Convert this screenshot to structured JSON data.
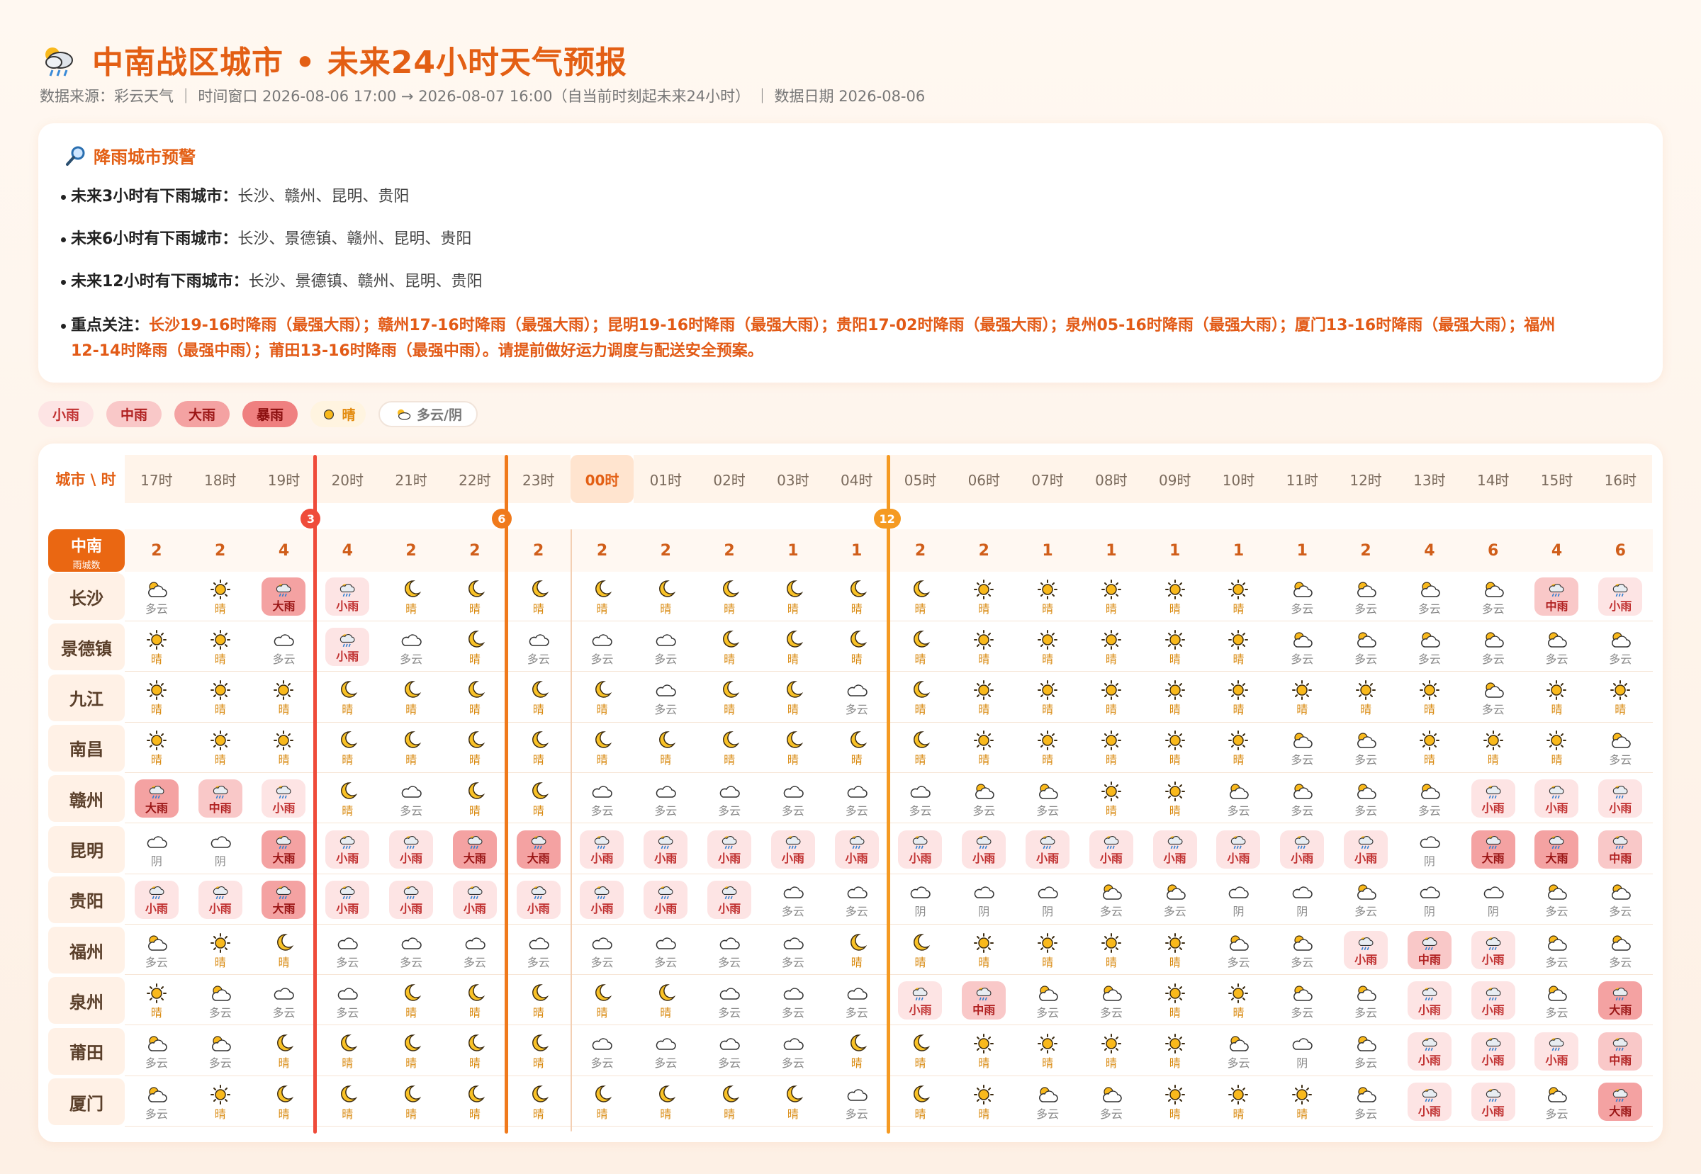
{
  "header": {
    "title": "中南战区城市 • 未来24小时天气预报",
    "subtitle": "数据来源：彩云天气 ｜ 时间窗口 2026-08-06 17:00 → 2026-08-07 16:00（自当前时刻起未来24小时） ｜ 数据日期 2026-08-06",
    "title_icon": "cloud-rain-sun-icon"
  },
  "alert": {
    "title": "降雨城市预警",
    "icon": "magnifier-icon",
    "lines": [
      {
        "label": "未来3小时有下雨城市：",
        "text": "长沙、赣州、昆明、贵阳"
      },
      {
        "label": "未来6小时有下雨城市：",
        "text": "长沙、景德镇、赣州、昆明、贵阳"
      },
      {
        "label": "未来12小时有下雨城市：",
        "text": "长沙、景德镇、赣州、昆明、贵阳"
      }
    ],
    "focus_label": "重点关注：",
    "focus_line1": "长沙19-16时降雨（最强大雨）；赣州17-16时降雨（最强大雨）；昆明19-16时降雨（最强大雨）；贵阳17-02时降雨（最强大雨）；泉州05-16时降雨（最强大雨）；厦门13-16时降雨（最强大雨）；福州",
    "focus_line2": "12-14时降雨（最强中雨）；莆田13-16时降雨（最强中雨）。请提前做好运力调度与配送安全预案。"
  },
  "legend": {
    "xs": "小雨",
    "md": "中雨",
    "lg": "大雨",
    "hv": "暴雨",
    "sun": "晴",
    "cloud": "多云/阴"
  },
  "table": {
    "corner": "城市 \\ 时",
    "summary_label": "中南",
    "summary_sub": "雨城数",
    "hours": [
      "17时",
      "18时",
      "19时",
      "20时",
      "21时",
      "22时",
      "23时",
      "00时",
      "01时",
      "02时",
      "03时",
      "04时",
      "05时",
      "06时",
      "07时",
      "08时",
      "09时",
      "10时",
      "11时",
      "12时",
      "13时",
      "14时",
      "15时",
      "16时"
    ],
    "now_index": 7,
    "rain_counts": [
      2,
      2,
      4,
      4,
      2,
      2,
      2,
      2,
      2,
      2,
      1,
      1,
      2,
      2,
      1,
      1,
      1,
      1,
      1,
      2,
      4,
      6,
      4,
      6
    ],
    "markers": [
      {
        "label": "3",
        "after": 2,
        "color": "#ef4b3a"
      },
      {
        "label": "6",
        "after": 5,
        "color": "#f07a1c"
      },
      {
        "label": "12",
        "after": 11,
        "color": "#f59a22"
      }
    ],
    "cities": [
      {
        "name": "长沙",
        "cells": [
          [
            "pc",
            "多云"
          ],
          [
            "su",
            "晴"
          ],
          [
            "r3",
            "大雨"
          ],
          [
            "r1",
            "小雨"
          ],
          [
            "mo",
            "晴"
          ],
          [
            "mo",
            "晴"
          ],
          [
            "mo",
            "晴"
          ],
          [
            "mo",
            "晴"
          ],
          [
            "mo",
            "晴"
          ],
          [
            "mo",
            "晴"
          ],
          [
            "mo",
            "晴"
          ],
          [
            "mo",
            "晴"
          ],
          [
            "mo",
            "晴"
          ],
          [
            "su",
            "晴"
          ],
          [
            "su",
            "晴"
          ],
          [
            "su",
            "晴"
          ],
          [
            "su",
            "晴"
          ],
          [
            "su",
            "晴"
          ],
          [
            "pc",
            "多云"
          ],
          [
            "pc",
            "多云"
          ],
          [
            "pc",
            "多云"
          ],
          [
            "pc",
            "多云"
          ],
          [
            "r2",
            "中雨"
          ],
          [
            "r1",
            "小雨"
          ]
        ]
      },
      {
        "name": "景德镇",
        "cells": [
          [
            "su",
            "晴"
          ],
          [
            "su",
            "晴"
          ],
          [
            "cl",
            "多云"
          ],
          [
            "r1",
            "小雨"
          ],
          [
            "cl",
            "多云"
          ],
          [
            "mo",
            "晴"
          ],
          [
            "cl",
            "多云"
          ],
          [
            "cl",
            "多云"
          ],
          [
            "cl",
            "多云"
          ],
          [
            "mo",
            "晴"
          ],
          [
            "mo",
            "晴"
          ],
          [
            "mo",
            "晴"
          ],
          [
            "mo",
            "晴"
          ],
          [
            "su",
            "晴"
          ],
          [
            "su",
            "晴"
          ],
          [
            "su",
            "晴"
          ],
          [
            "su",
            "晴"
          ],
          [
            "su",
            "晴"
          ],
          [
            "pc",
            "多云"
          ],
          [
            "pc",
            "多云"
          ],
          [
            "pc",
            "多云"
          ],
          [
            "pc",
            "多云"
          ],
          [
            "pc",
            "多云"
          ],
          [
            "pc",
            "多云"
          ]
        ]
      },
      {
        "name": "九江",
        "cells": [
          [
            "su",
            "晴"
          ],
          [
            "su",
            "晴"
          ],
          [
            "su",
            "晴"
          ],
          [
            "mo",
            "晴"
          ],
          [
            "mo",
            "晴"
          ],
          [
            "mo",
            "晴"
          ],
          [
            "mo",
            "晴"
          ],
          [
            "mo",
            "晴"
          ],
          [
            "cl",
            "多云"
          ],
          [
            "mo",
            "晴"
          ],
          [
            "mo",
            "晴"
          ],
          [
            "cl",
            "多云"
          ],
          [
            "mo",
            "晴"
          ],
          [
            "su",
            "晴"
          ],
          [
            "su",
            "晴"
          ],
          [
            "su",
            "晴"
          ],
          [
            "su",
            "晴"
          ],
          [
            "su",
            "晴"
          ],
          [
            "su",
            "晴"
          ],
          [
            "su",
            "晴"
          ],
          [
            "su",
            "晴"
          ],
          [
            "pc",
            "多云"
          ],
          [
            "su",
            "晴"
          ],
          [
            "su",
            "晴"
          ]
        ]
      },
      {
        "name": "南昌",
        "cells": [
          [
            "su",
            "晴"
          ],
          [
            "su",
            "晴"
          ],
          [
            "su",
            "晴"
          ],
          [
            "mo",
            "晴"
          ],
          [
            "mo",
            "晴"
          ],
          [
            "mo",
            "晴"
          ],
          [
            "mo",
            "晴"
          ],
          [
            "mo",
            "晴"
          ],
          [
            "mo",
            "晴"
          ],
          [
            "mo",
            "晴"
          ],
          [
            "mo",
            "晴"
          ],
          [
            "mo",
            "晴"
          ],
          [
            "mo",
            "晴"
          ],
          [
            "su",
            "晴"
          ],
          [
            "su",
            "晴"
          ],
          [
            "su",
            "晴"
          ],
          [
            "su",
            "晴"
          ],
          [
            "su",
            "晴"
          ],
          [
            "pc",
            "多云"
          ],
          [
            "pc",
            "多云"
          ],
          [
            "su",
            "晴"
          ],
          [
            "su",
            "晴"
          ],
          [
            "su",
            "晴"
          ],
          [
            "pc",
            "多云"
          ]
        ]
      },
      {
        "name": "赣州",
        "cells": [
          [
            "r3",
            "大雨"
          ],
          [
            "r2",
            "中雨"
          ],
          [
            "r1",
            "小雨"
          ],
          [
            "mo",
            "晴"
          ],
          [
            "cl",
            "多云"
          ],
          [
            "mo",
            "晴"
          ],
          [
            "mo",
            "晴"
          ],
          [
            "cl",
            "多云"
          ],
          [
            "cl",
            "多云"
          ],
          [
            "cl",
            "多云"
          ],
          [
            "cl",
            "多云"
          ],
          [
            "cl",
            "多云"
          ],
          [
            "cl",
            "多云"
          ],
          [
            "pc",
            "多云"
          ],
          [
            "pc",
            "多云"
          ],
          [
            "su",
            "晴"
          ],
          [
            "su",
            "晴"
          ],
          [
            "pc",
            "多云"
          ],
          [
            "pc",
            "多云"
          ],
          [
            "pc",
            "多云"
          ],
          [
            "pc",
            "多云"
          ],
          [
            "r1",
            "小雨"
          ],
          [
            "r1",
            "小雨"
          ],
          [
            "r1",
            "小雨"
          ]
        ]
      },
      {
        "name": "昆明",
        "cells": [
          [
            "cl",
            "阴"
          ],
          [
            "cl",
            "阴"
          ],
          [
            "r3",
            "大雨"
          ],
          [
            "r1",
            "小雨"
          ],
          [
            "r1",
            "小雨"
          ],
          [
            "r3",
            "大雨"
          ],
          [
            "r3",
            "大雨"
          ],
          [
            "r1",
            "小雨"
          ],
          [
            "r1",
            "小雨"
          ],
          [
            "r1",
            "小雨"
          ],
          [
            "r1",
            "小雨"
          ],
          [
            "r1",
            "小雨"
          ],
          [
            "r1",
            "小雨"
          ],
          [
            "r1",
            "小雨"
          ],
          [
            "r1",
            "小雨"
          ],
          [
            "r1",
            "小雨"
          ],
          [
            "r1",
            "小雨"
          ],
          [
            "r1",
            "小雨"
          ],
          [
            "r1",
            "小雨"
          ],
          [
            "r1",
            "小雨"
          ],
          [
            "cl",
            "阴"
          ],
          [
            "r3",
            "大雨"
          ],
          [
            "r3",
            "大雨"
          ],
          [
            "r2",
            "中雨"
          ]
        ]
      },
      {
        "name": "贵阳",
        "cells": [
          [
            "r1",
            "小雨"
          ],
          [
            "r1",
            "小雨"
          ],
          [
            "r3",
            "大雨"
          ],
          [
            "r1",
            "小雨"
          ],
          [
            "r1",
            "小雨"
          ],
          [
            "r1",
            "小雨"
          ],
          [
            "r1",
            "小雨"
          ],
          [
            "r1",
            "小雨"
          ],
          [
            "r1",
            "小雨"
          ],
          [
            "r1",
            "小雨"
          ],
          [
            "cl",
            "多云"
          ],
          [
            "cl",
            "多云"
          ],
          [
            "cl",
            "阴"
          ],
          [
            "cl",
            "阴"
          ],
          [
            "cl",
            "阴"
          ],
          [
            "pc",
            "多云"
          ],
          [
            "pc",
            "多云"
          ],
          [
            "cl",
            "阴"
          ],
          [
            "cl",
            "阴"
          ],
          [
            "pc",
            "多云"
          ],
          [
            "cl",
            "阴"
          ],
          [
            "cl",
            "阴"
          ],
          [
            "pc",
            "多云"
          ],
          [
            "pc",
            "多云"
          ]
        ]
      },
      {
        "name": "福州",
        "cells": [
          [
            "pc",
            "多云"
          ],
          [
            "su",
            "晴"
          ],
          [
            "mo",
            "晴"
          ],
          [
            "cl",
            "多云"
          ],
          [
            "cl",
            "多云"
          ],
          [
            "cl",
            "多云"
          ],
          [
            "cl",
            "多云"
          ],
          [
            "cl",
            "多云"
          ],
          [
            "cl",
            "多云"
          ],
          [
            "cl",
            "多云"
          ],
          [
            "cl",
            "多云"
          ],
          [
            "mo",
            "晴"
          ],
          [
            "mo",
            "晴"
          ],
          [
            "su",
            "晴"
          ],
          [
            "su",
            "晴"
          ],
          [
            "su",
            "晴"
          ],
          [
            "su",
            "晴"
          ],
          [
            "pc",
            "多云"
          ],
          [
            "pc",
            "多云"
          ],
          [
            "r1",
            "小雨"
          ],
          [
            "r2",
            "中雨"
          ],
          [
            "r1",
            "小雨"
          ],
          [
            "pc",
            "多云"
          ],
          [
            "pc",
            "多云"
          ]
        ]
      },
      {
        "name": "泉州",
        "cells": [
          [
            "su",
            "晴"
          ],
          [
            "pc",
            "多云"
          ],
          [
            "cl",
            "多云"
          ],
          [
            "cl",
            "多云"
          ],
          [
            "mo",
            "晴"
          ],
          [
            "mo",
            "晴"
          ],
          [
            "mo",
            "晴"
          ],
          [
            "mo",
            "晴"
          ],
          [
            "mo",
            "晴"
          ],
          [
            "cl",
            "多云"
          ],
          [
            "cl",
            "多云"
          ],
          [
            "cl",
            "多云"
          ],
          [
            "r1",
            "小雨"
          ],
          [
            "r2",
            "中雨"
          ],
          [
            "pc",
            "多云"
          ],
          [
            "pc",
            "多云"
          ],
          [
            "su",
            "晴"
          ],
          [
            "su",
            "晴"
          ],
          [
            "pc",
            "多云"
          ],
          [
            "pc",
            "多云"
          ],
          [
            "r1",
            "小雨"
          ],
          [
            "r1",
            "小雨"
          ],
          [
            "pc",
            "多云"
          ],
          [
            "r3",
            "大雨"
          ]
        ]
      },
      {
        "name": "莆田",
        "cells": [
          [
            "pc",
            "多云"
          ],
          [
            "pc",
            "多云"
          ],
          [
            "mo",
            "晴"
          ],
          [
            "mo",
            "晴"
          ],
          [
            "mo",
            "晴"
          ],
          [
            "mo",
            "晴"
          ],
          [
            "mo",
            "晴"
          ],
          [
            "cl",
            "多云"
          ],
          [
            "cl",
            "多云"
          ],
          [
            "cl",
            "多云"
          ],
          [
            "cl",
            "多云"
          ],
          [
            "mo",
            "晴"
          ],
          [
            "mo",
            "晴"
          ],
          [
            "su",
            "晴"
          ],
          [
            "su",
            "晴"
          ],
          [
            "su",
            "晴"
          ],
          [
            "su",
            "晴"
          ],
          [
            "pc",
            "多云"
          ],
          [
            "cl",
            "阴"
          ],
          [
            "pc",
            "多云"
          ],
          [
            "r1",
            "小雨"
          ],
          [
            "r1",
            "小雨"
          ],
          [
            "r1",
            "小雨"
          ],
          [
            "r2",
            "中雨"
          ]
        ]
      },
      {
        "name": "厦门",
        "cells": [
          [
            "pc",
            "多云"
          ],
          [
            "su",
            "晴"
          ],
          [
            "mo",
            "晴"
          ],
          [
            "mo",
            "晴"
          ],
          [
            "mo",
            "晴"
          ],
          [
            "mo",
            "晴"
          ],
          [
            "mo",
            "晴"
          ],
          [
            "mo",
            "晴"
          ],
          [
            "mo",
            "晴"
          ],
          [
            "mo",
            "晴"
          ],
          [
            "mo",
            "晴"
          ],
          [
            "cl",
            "多云"
          ],
          [
            "mo",
            "晴"
          ],
          [
            "su",
            "晴"
          ],
          [
            "pc",
            "多云"
          ],
          [
            "pc",
            "多云"
          ],
          [
            "su",
            "晴"
          ],
          [
            "su",
            "晴"
          ],
          [
            "su",
            "晴"
          ],
          [
            "pc",
            "多云"
          ],
          [
            "r1",
            "小雨"
          ],
          [
            "r1",
            "小雨"
          ],
          [
            "pc",
            "多云"
          ],
          [
            "r3",
            "大雨"
          ]
        ]
      }
    ]
  }
}
